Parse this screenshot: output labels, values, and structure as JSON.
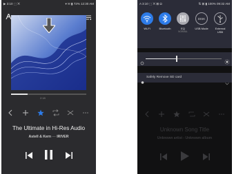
{
  "colors": {
    "panel_bg": "#2b2b2e",
    "accent_blue": "#2d7be8",
    "qs_panel": "#2b2c38",
    "screen_dark": "#111112"
  },
  "left_screen": {
    "statusbar": {
      "left": "▶ 3:10 ⬚ ⨉",
      "right": "▾ ✉ ▮ 72% 12:30 AM"
    },
    "logo_icon": "astell-kern-logo-icon",
    "menu_icon": "menu-icon",
    "arrow_icon": "down-arrow-icon",
    "player": {
      "elapsed": "",
      "current_time": "2:18",
      "total_time": "",
      "progress": 0.22,
      "title": "The Ultimate in Hi-Res Audio",
      "artist": "Astell & Kern",
      "album": "IRIVER",
      "artist_separator": "—"
    },
    "controls": [
      "back-icon",
      "add-icon",
      "star-icon",
      "repeat-icon",
      "shuffle-icon",
      "more-icon"
    ],
    "transport": [
      "previous-icon",
      "pause-icon",
      "next-icon"
    ]
  },
  "right_screen": {
    "statusbar": {
      "left": "A 3:10 ⬚ ⨉ ⊠ Ω",
      "right": "⇅ ⊠ ▮ 100% 09:32 AM"
    },
    "quick_settings": [
      {
        "label": "Wi-Fi",
        "sub": "",
        "active": true,
        "icon": "wifi-icon"
      },
      {
        "label": "Bluetooth",
        "sub": "",
        "active": true,
        "icon": "bluetooth-icon"
      },
      {
        "label": "EQ",
        "sub": "NORMAL",
        "active": false,
        "icon": "eq-icon"
      },
      {
        "label": "USB Mode",
        "sub": "",
        "active": false,
        "icon": "disk-icon"
      },
      {
        "label": "External",
        "label2": "USB",
        "sub": "",
        "active": false,
        "icon": "usb-icon"
      }
    ],
    "disk_label": "DISK",
    "brightness_level": 0.4,
    "notification": {
      "text": "Safely Remove SD card"
    },
    "player": {
      "title": "Unknown Song Title",
      "subtitle": "Unknown artist - Unknown album"
    },
    "transport": [
      "previous-icon",
      "play-icon",
      "next-icon"
    ]
  }
}
